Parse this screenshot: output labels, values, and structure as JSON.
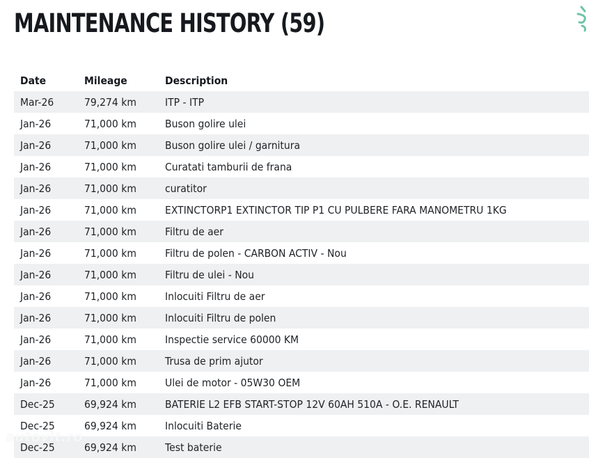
{
  "page_title": "MAINTENANCE HISTORY (59)",
  "columns": {
    "date": "Date",
    "mileage": "Mileage",
    "description": "Description"
  },
  "rows": [
    {
      "date": "Mar-26",
      "mileage": "79,274 km",
      "description": "ITP - ITP"
    },
    {
      "date": "Jan-26",
      "mileage": "71,000 km",
      "description": "Buson golire ulei"
    },
    {
      "date": "Jan-26",
      "mileage": "71,000 km",
      "description": "Buson golire ulei / garnitura"
    },
    {
      "date": "Jan-26",
      "mileage": "71,000 km",
      "description": "Curatati tamburii de frana"
    },
    {
      "date": "Jan-26",
      "mileage": "71,000 km",
      "description": "curatitor"
    },
    {
      "date": "Jan-26",
      "mileage": "71,000 km",
      "description": "EXTINCTORP1 EXTINCTOR TIP P1 CU PULBERE FARA MANOMETRU 1KG"
    },
    {
      "date": "Jan-26",
      "mileage": "71,000 km",
      "description": "Filtru de aer"
    },
    {
      "date": "Jan-26",
      "mileage": "71,000 km",
      "description": "Filtru de polen - CARBON ACTIV - Nou"
    },
    {
      "date": "Jan-26",
      "mileage": "71,000 km",
      "description": "Filtru de ulei - Nou"
    },
    {
      "date": "Jan-26",
      "mileage": "71,000 km",
      "description": "Inlocuiti Filtru de aer"
    },
    {
      "date": "Jan-26",
      "mileage": "71,000 km",
      "description": "Inlocuiti Filtru de polen"
    },
    {
      "date": "Jan-26",
      "mileage": "71,000 km",
      "description": "Inspectie service 60000 KM"
    },
    {
      "date": "Jan-26",
      "mileage": "71,000 km",
      "description": "Trusa de prim ajutor"
    },
    {
      "date": "Jan-26",
      "mileage": "71,000 km",
      "description": "Ulei de motor - 05W30 OEM"
    },
    {
      "date": "Dec-25",
      "mileage": "69,924 km",
      "description": "BATERIE L2 EFB START-STOP 12V 60AH 510A - O.E. RENAULT"
    },
    {
      "date": "Dec-25",
      "mileage": "69,924 km",
      "description": "Inlocuiti Baterie"
    },
    {
      "date": "Dec-25",
      "mileage": "69,924 km",
      "description": "Test baterie"
    }
  ],
  "watermark": "autovit.ro",
  "colors": {
    "stripe": "#eef0f2",
    "text": "#1f2226",
    "accent": "#6fc3a8"
  },
  "icons": {
    "corner": "partial-brand-icon"
  }
}
